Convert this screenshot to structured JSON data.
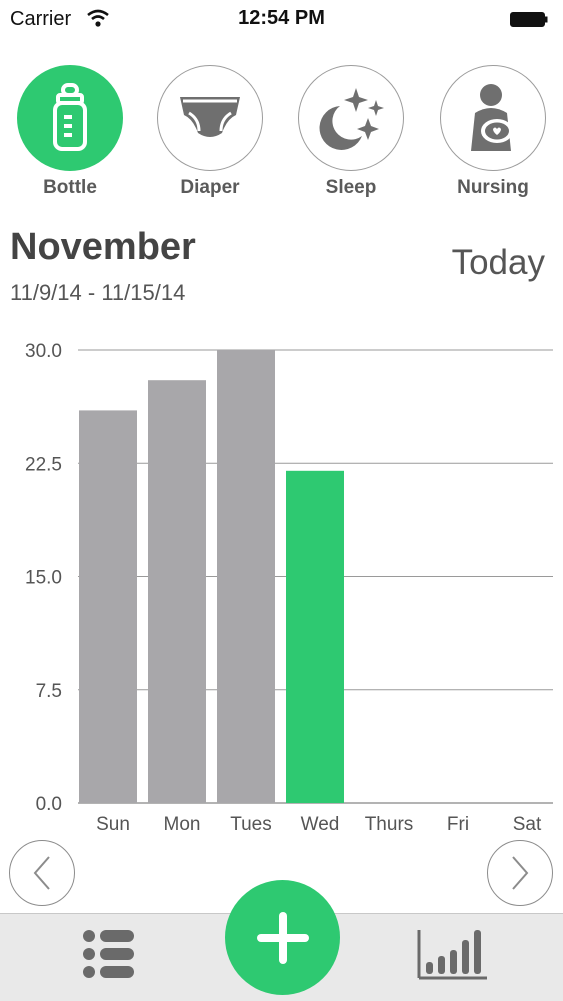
{
  "status_bar": {
    "carrier": "Carrier",
    "time": "12:54 PM"
  },
  "categories": [
    {
      "label": "Bottle",
      "icon": "bottle-icon",
      "active": true
    },
    {
      "label": "Diaper",
      "icon": "diaper-icon",
      "active": false
    },
    {
      "label": "Sleep",
      "icon": "sleep-moon-stars-icon",
      "active": false
    },
    {
      "label": "Nursing",
      "icon": "nursing-mother-icon",
      "active": false
    }
  ],
  "header": {
    "month": "November",
    "date_range": "11/9/14 - 11/15/14",
    "today_label": "Today"
  },
  "colors": {
    "accent": "#2ec971",
    "bar": "#a8a7aa",
    "grid": "#9a9a9a",
    "text": "#555555"
  },
  "chart_data": {
    "type": "bar",
    "categories": [
      "Sun",
      "Mon",
      "Tues",
      "Wed",
      "Thurs",
      "Fri",
      "Sat"
    ],
    "values": [
      26,
      28,
      30,
      22,
      0,
      0,
      0
    ],
    "highlight_index": 3,
    "y_ticks": [
      "0.0",
      "7.5",
      "15.0",
      "22.5",
      "30.0"
    ],
    "ylim": [
      0,
      30
    ],
    "grid": true
  },
  "nav": {
    "prev": "previous-week",
    "next": "next-week"
  },
  "tab_bar": {
    "list_icon": "list-icon",
    "add_icon": "add-icon",
    "stats_icon": "bar-chart-icon"
  }
}
